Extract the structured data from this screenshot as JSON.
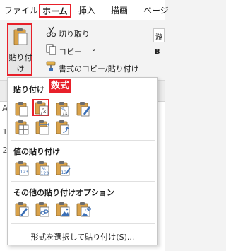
{
  "ribbon_tabs": {
    "file": "ファイル",
    "home": "ホーム",
    "insert": "挿入",
    "draw": "描画",
    "page": "ページ"
  },
  "clipboard": {
    "paste_label": "貼り付け",
    "paste_arrow": "⌄",
    "cut_label": "切り取り",
    "copy_label": "コピー",
    "copy_dropdown": "⌄",
    "format_painter_label": "書式のコピー/貼り付け"
  },
  "ribbon_right": {
    "font_box_text": "游",
    "bold_text": "B"
  },
  "sheet": {
    "col_header": "A",
    "row_numbers": [
      "1",
      "2"
    ]
  },
  "paste_menu": {
    "section_paste": "貼り付け",
    "callout": "数式",
    "section_values": "値の貼り付け",
    "section_other": "その他の貼り付けオプション",
    "footer": "形式を選択して貼り付け(S)...",
    "paste_icons": [
      "paste-icon",
      "paste-formulas-icon",
      "paste-formulas-number-format-icon",
      "paste-keep-source-formatting-icon",
      "paste-no-borders-icon",
      "paste-keep-column-widths-icon",
      "paste-transpose-icon"
    ],
    "value_icons": [
      "paste-values-icon",
      "paste-values-number-format-icon",
      "paste-values-source-formatting-icon"
    ],
    "other_icons": [
      "paste-formatting-icon",
      "paste-link-icon",
      "paste-picture-icon",
      "paste-linked-picture-icon"
    ]
  },
  "colors": {
    "highlight_red": "#e8202a",
    "icon_blue": "#3b6fb6",
    "clipboard_orange": "#d9a24a"
  }
}
